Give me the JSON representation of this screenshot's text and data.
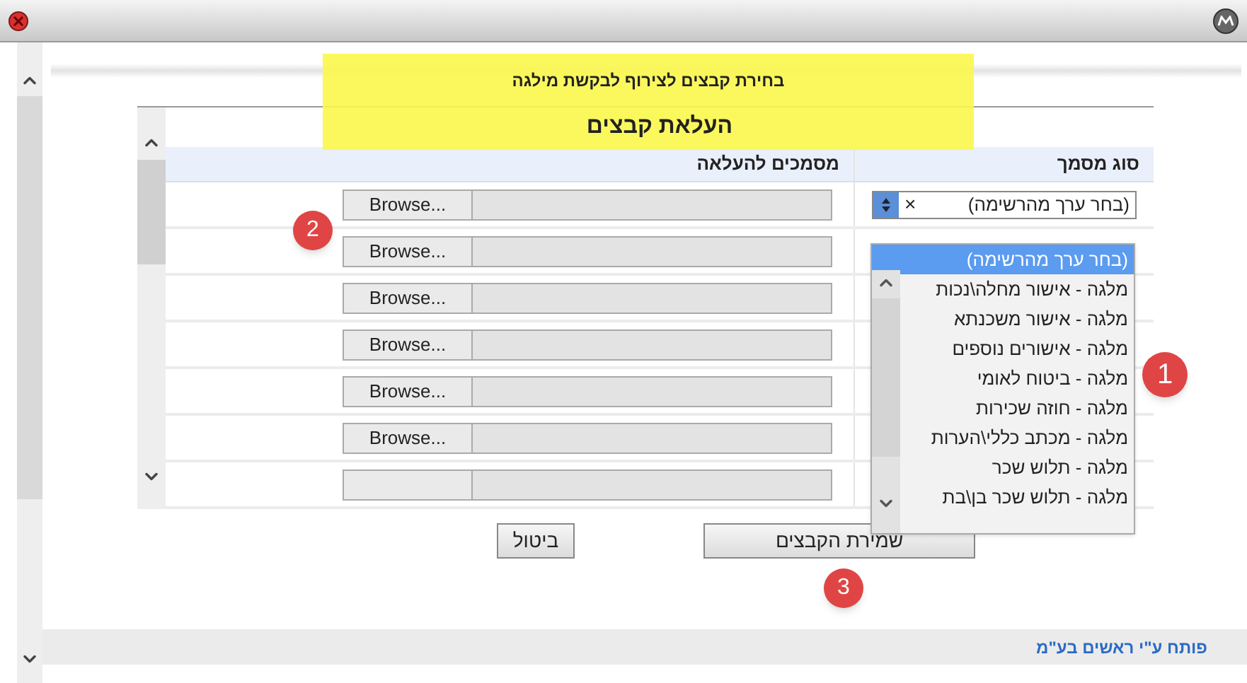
{
  "page_title": "בחירת קבצים לצירוף לבקשת מילגה",
  "panel": {
    "title": "העלאת קבצים",
    "columns": [
      "סוג מסמך",
      "מסמכים להעלאה"
    ],
    "rows": [
      {
        "browse_label": "Browse..."
      },
      {
        "browse_label": "Browse..."
      },
      {
        "browse_label": "Browse..."
      },
      {
        "browse_label": "Browse..."
      },
      {
        "browse_label": "Browse..."
      },
      {
        "browse_label": "Browse..."
      },
      {}
    ]
  },
  "select": {
    "value": "(בחר ערך מהרשימה)",
    "clear": "×"
  },
  "dropdown": {
    "options": [
      {
        "label": "(בחר ערך מהרשימה)",
        "selected": true
      },
      {
        "label": "מלגה - אישור מחלה\\נכות",
        "selected": false
      },
      {
        "label": "מלגה - אישור משכנתא",
        "selected": false
      },
      {
        "label": "מלגה - אישורים נוספים",
        "selected": false
      },
      {
        "label": "מלגה - ביטוח לאומי",
        "selected": false
      },
      {
        "label": "מלגה - חוזה שכירות",
        "selected": false
      },
      {
        "label": "מלגה - מכתב כללי\\הערות",
        "selected": false
      },
      {
        "label": "מלגה - תלוש שכר",
        "selected": false
      },
      {
        "label": "מלגה - תלוש שכר בן\\בת",
        "selected": false
      }
    ]
  },
  "buttons": [
    {
      "kind": "save",
      "label": "שמירת הקבצים"
    },
    {
      "kind": "cancel",
      "label": "ביטול"
    }
  ],
  "footer": {
    "link": "פותח ע\"י ראשים בע\"מ"
  },
  "badges": [
    {
      "label": "1",
      "kind": "large"
    },
    {
      "label": "2",
      "kind": "small"
    },
    {
      "label": "3",
      "kind": "small"
    }
  ]
}
